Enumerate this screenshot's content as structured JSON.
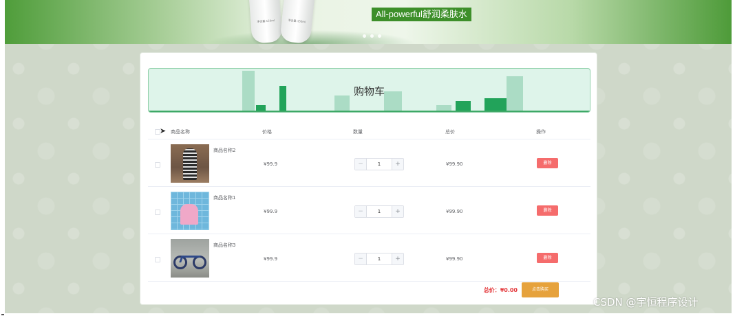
{
  "banner": {
    "slogan": "All-powerful舒润柔肤水",
    "bottle_label_1": "净含量:150ml",
    "bottle_label_2": "净含量:150ml"
  },
  "cart": {
    "title": "购物车",
    "columns": {
      "name": "商品名称",
      "price": "价格",
      "quantity": "数量",
      "total": "总价",
      "actions": "操作"
    },
    "items": [
      {
        "name": "商品名称2",
        "price": "¥99.9",
        "quantity": "1",
        "total": "¥99.90",
        "delete_label": "删除",
        "image": "dress-photo"
      },
      {
        "name": "商品名称1",
        "price": "¥99.9",
        "quantity": "1",
        "total": "¥99.90",
        "delete_label": "删除",
        "image": "children-toy-photo"
      },
      {
        "name": "商品名称3",
        "price": "¥99.9",
        "quantity": "1",
        "total": "¥99.90",
        "delete_label": "删除",
        "image": "bicycle-photo"
      }
    ],
    "summary": {
      "total_label": "总价：",
      "total_value": "¥0.00"
    },
    "buy_label": "点击购买",
    "stepper": {
      "minus": "−",
      "plus": "+"
    }
  },
  "watermark": "CSDN @宇恒程序设计",
  "colors": {
    "banner_green": "#4f9d3a",
    "title_bg": "#def4ea",
    "delete_red": "#f56c6c",
    "buy_orange": "#e6a23c",
    "total_red": "#e4393c"
  }
}
